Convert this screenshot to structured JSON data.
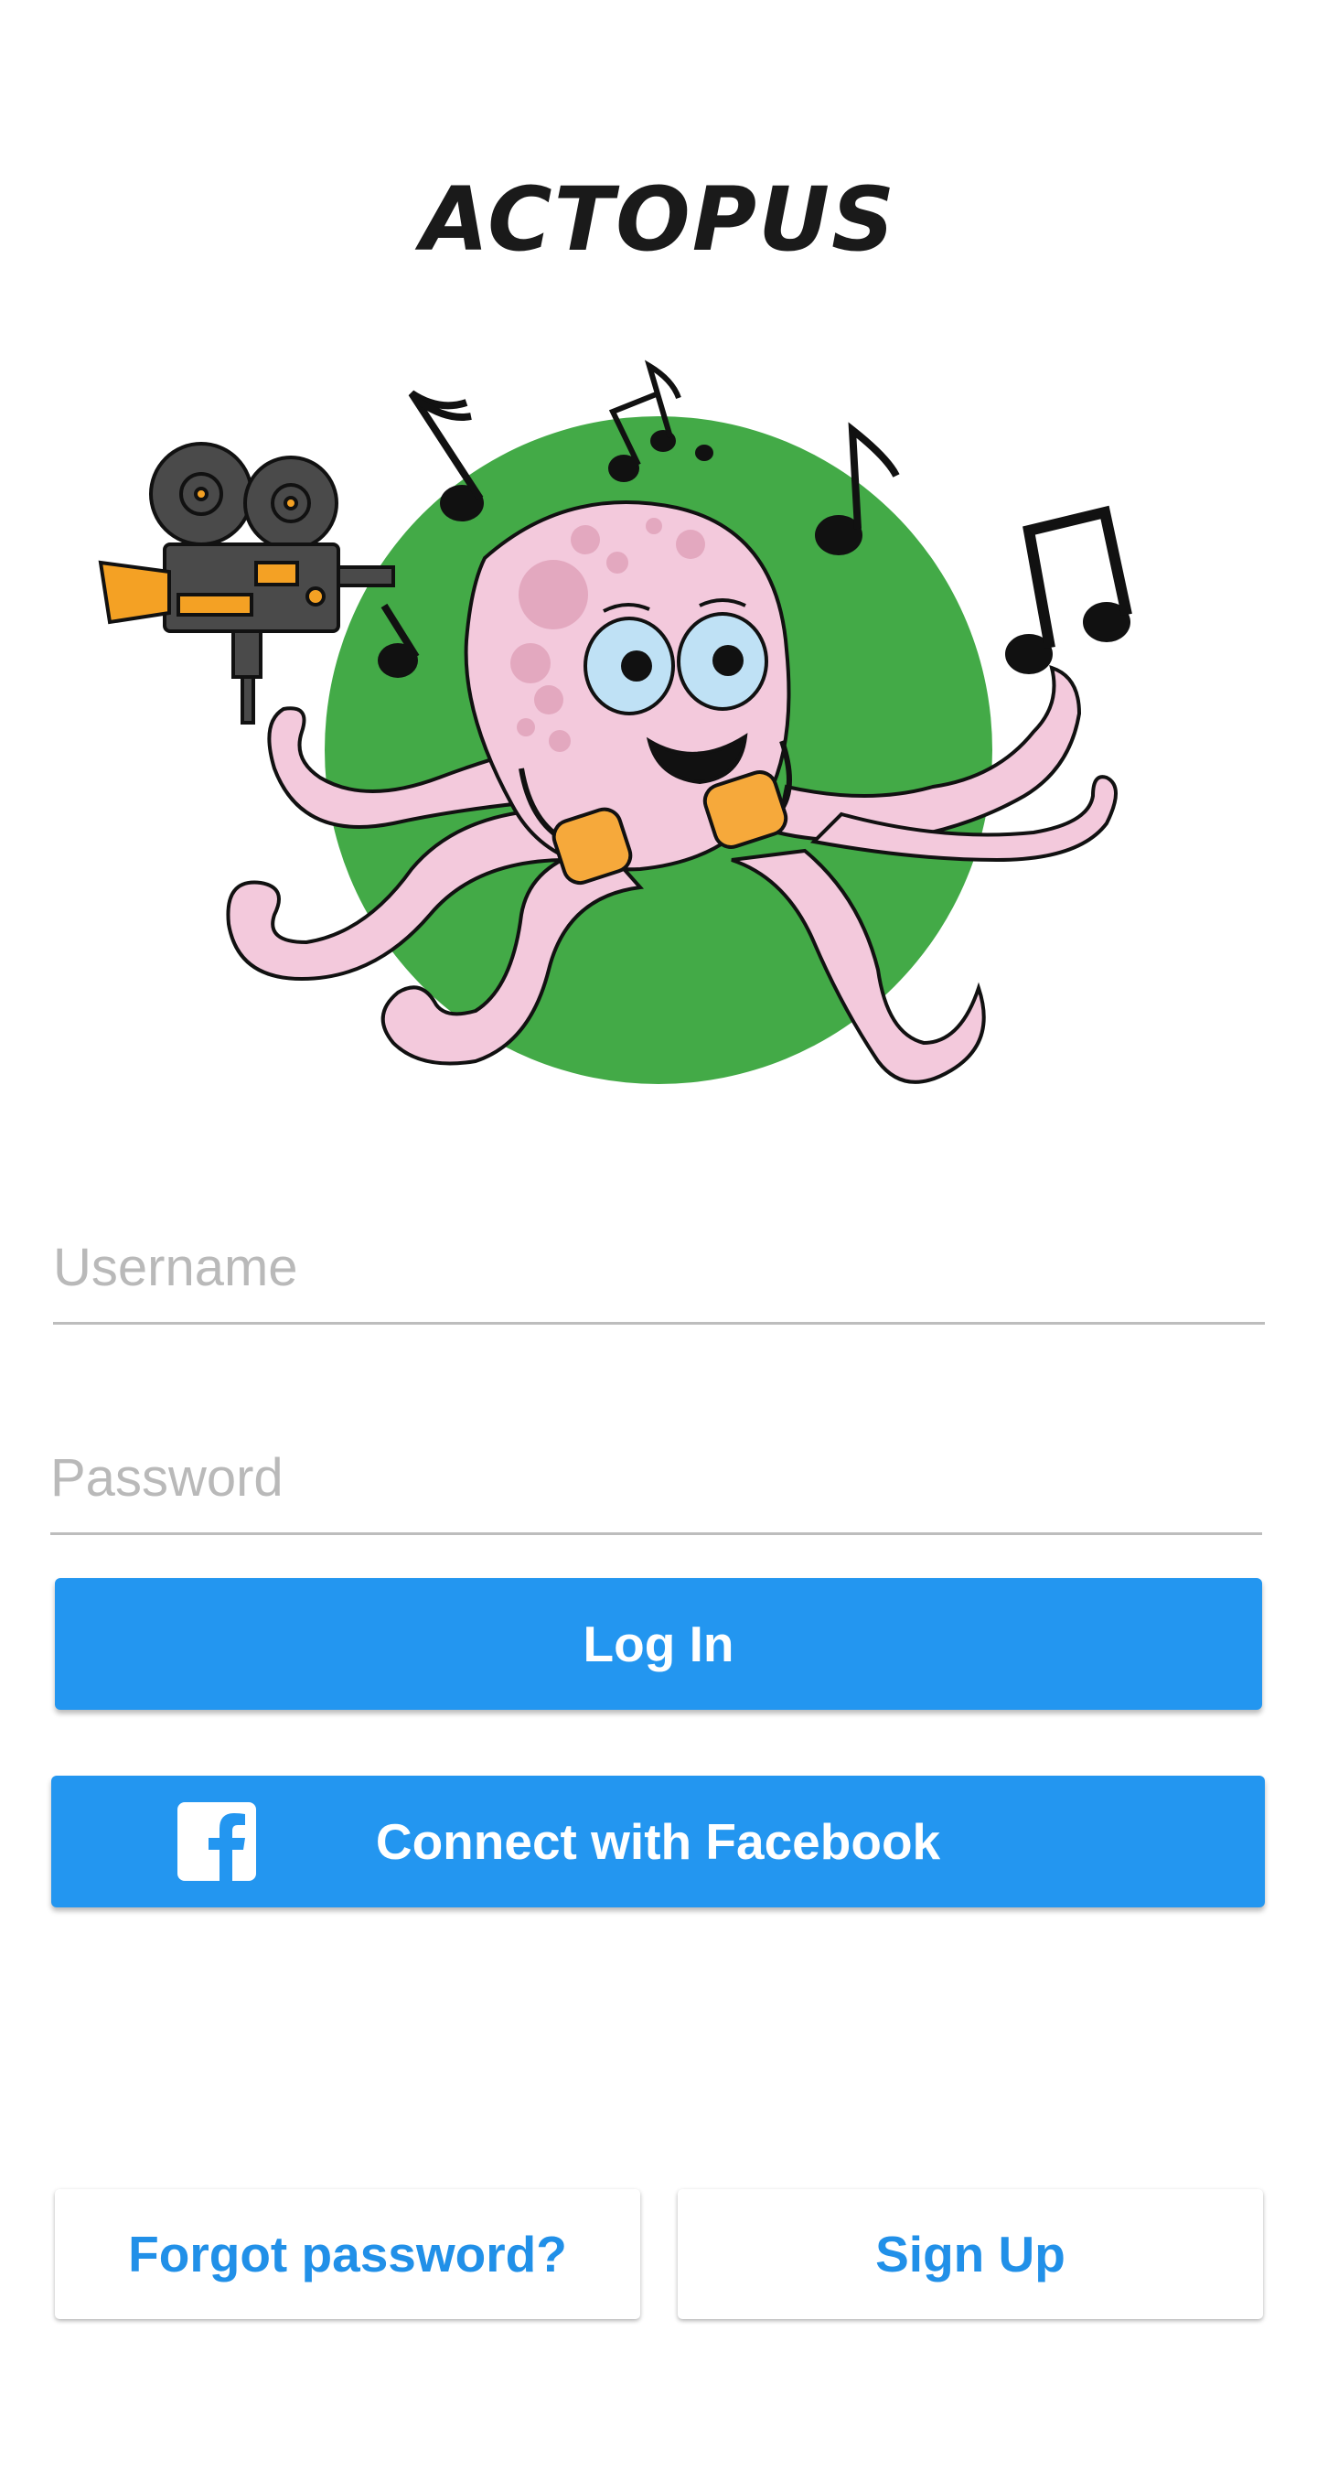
{
  "app": {
    "title": "ACTOPUS"
  },
  "mascot": {
    "name": "octopus-mascot",
    "colors": {
      "circle": "#43aa47",
      "body": "#f3c9dc",
      "spots": "#e3a8bf",
      "headphones": "#f6a93b",
      "camera_body": "#4a4a4a",
      "camera_lens": "#f4a124"
    }
  },
  "form": {
    "username_placeholder": "Username",
    "username_value": "",
    "password_placeholder": "Password",
    "password_value": ""
  },
  "buttons": {
    "login_label": "Log In",
    "facebook_label": "Connect with Facebook",
    "forgot_label": "Forgot password?",
    "signup_label": "Sign Up"
  },
  "icons": {
    "facebook": "facebook-icon"
  },
  "colors": {
    "primary": "#2396f0",
    "link": "#2190e8",
    "placeholder": "#b9b9b9",
    "underline": "#bdbdbd"
  }
}
